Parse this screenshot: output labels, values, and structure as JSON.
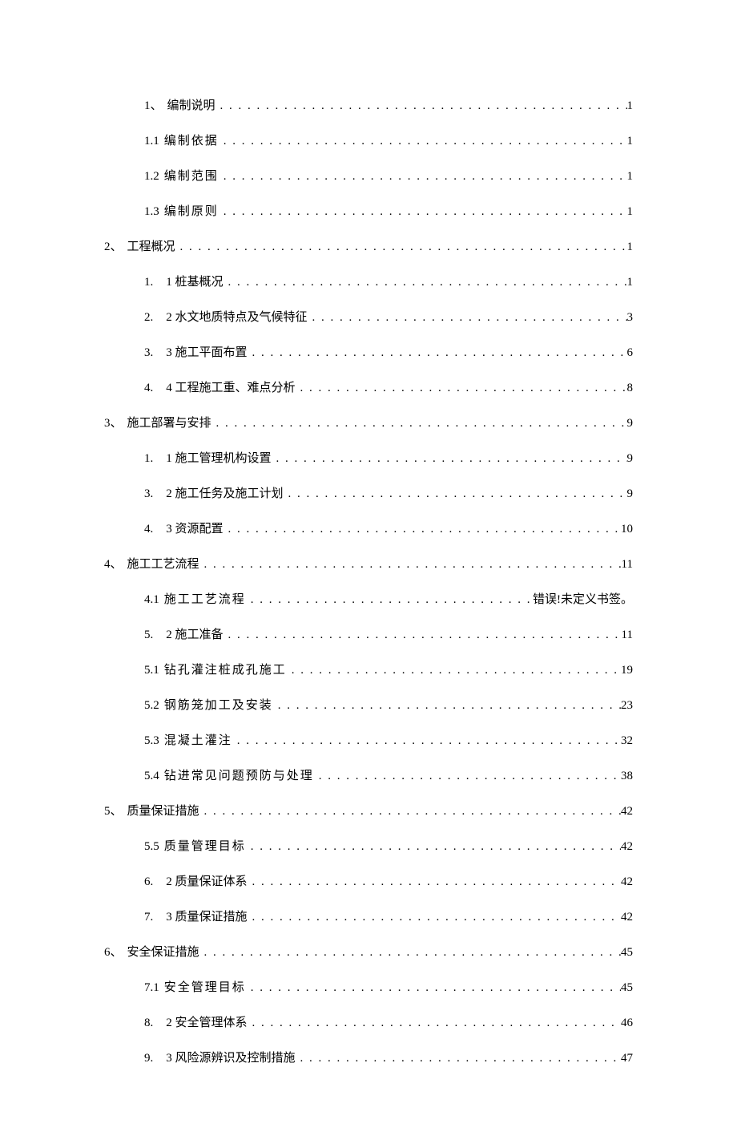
{
  "toc": [
    {
      "level": 1,
      "number": "1、",
      "title": "编制说明",
      "page": "1",
      "dotStyle": true
    },
    {
      "level": 2,
      "number": "1.1",
      "title": "编制依据",
      "page": "1",
      "spaced": true
    },
    {
      "level": 2,
      "number": "1.2",
      "title": "编制范围",
      "page": "1",
      "spaced": true
    },
    {
      "level": 2,
      "number": "1.3",
      "title": "编制原则",
      "page": "1",
      "spaced": true
    },
    {
      "level": 0,
      "number": "2、",
      "title": "工程概况",
      "page": "1",
      "dotStyle": true
    },
    {
      "level": 1,
      "number": "1.",
      "title": "1 桩基概况",
      "page": "1",
      "dotStyle": true,
      "numDot": true
    },
    {
      "level": 1,
      "number": "2.",
      "title": "2 水文地质特点及气候特征",
      "page": "3",
      "dotStyle": true,
      "numDot": true
    },
    {
      "level": 1,
      "number": "3.",
      "title": "3 施工平面布置",
      "page": "6",
      "dotStyle": true,
      "numDot": true
    },
    {
      "level": 1,
      "number": "4.",
      "title": "4 工程施工重、难点分析",
      "page": "8",
      "dotStyle": true,
      "numDot": true
    },
    {
      "level": 0,
      "number": "3、",
      "title": "施工部署与安排",
      "page": "9",
      "dotStyle": true
    },
    {
      "level": 1,
      "number": "1.",
      "title": "1 施工管理机构设置",
      "page": "9",
      "dotStyle": true,
      "numDot": true
    },
    {
      "level": 1,
      "number": "3.",
      "title": "2 施工任务及施工计划",
      "page": "9",
      "dotStyle": true,
      "numDot": true
    },
    {
      "level": 1,
      "number": "4.",
      "title": "3 资源配置",
      "page": "10",
      "dotStyle": true,
      "numDot": true
    },
    {
      "level": 0,
      "number": "4、",
      "title": "施工工艺流程",
      "page": "11",
      "dotStyle": true
    },
    {
      "level": 2,
      "number": "4.1",
      "title": "施工工艺流程",
      "page": "错误!未定义书签。",
      "spaced": true
    },
    {
      "level": 1,
      "number": "5.",
      "title": "2 施工准备",
      "page": "11",
      "dotStyle": true,
      "numDot": true
    },
    {
      "level": 2,
      "number": "5.1",
      "title": "钻孔灌注桩成孔施工",
      "page": "19",
      "spaced": true
    },
    {
      "level": 2,
      "number": "5.2",
      "title": "钢筋笼加工及安装",
      "page": "23",
      "spaced": true
    },
    {
      "level": 2,
      "number": "5.3",
      "title": "混凝土灌注",
      "page": "32",
      "spaced": true
    },
    {
      "level": 2,
      "number": "5.4",
      "title": "钻进常见问题预防与处理",
      "page": "38",
      "spaced": true
    },
    {
      "level": 0,
      "number": "5、",
      "title": "质量保证措施",
      "page": "42",
      "dotStyle": true
    },
    {
      "level": 2,
      "number": "5.5",
      "title": "质量管理目标",
      "page": "42",
      "spaced": true
    },
    {
      "level": 1,
      "number": "6.",
      "title": "2 质量保证体系",
      "page": "42",
      "dotStyle": true,
      "numDot": true
    },
    {
      "level": 1,
      "number": "7.",
      "title": "3 质量保证措施",
      "page": "42",
      "dotStyle": true,
      "numDot": true
    },
    {
      "level": 0,
      "number": "6、",
      "title": "安全保证措施",
      "page": "45",
      "dotStyle": true
    },
    {
      "level": 2,
      "number": "7.1",
      "title": "安全管理目标",
      "page": "45",
      "spaced": true
    },
    {
      "level": 1,
      "number": "8.",
      "title": "2 安全管理体系",
      "page": "46",
      "dotStyle": true,
      "numDot": true
    },
    {
      "level": 1,
      "number": "9.",
      "title": "3 风险源辨识及控制措施",
      "page": "47",
      "dotStyle": true,
      "numDot": true
    }
  ]
}
